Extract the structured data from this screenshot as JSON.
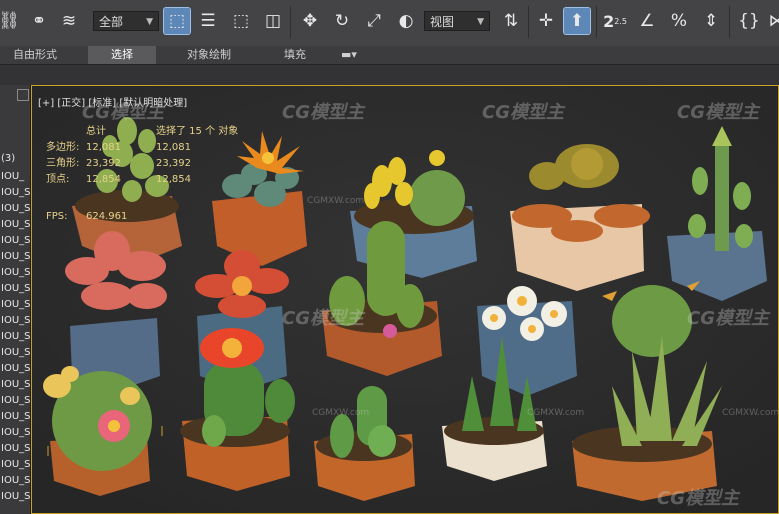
{
  "toolbar": {
    "filter_select": "全部",
    "ref_coord_select": "视图",
    "icons": [
      "link-icon",
      "unlink-icon",
      "bind-spacewarp-icon",
      "select-object-icon",
      "select-by-name-icon",
      "rect-region-icon",
      "window-crossing-icon",
      "move-icon",
      "rotate-icon",
      "scale-icon",
      "selection-lock-icon",
      "mirror-icon",
      "snap-toggle-icon",
      "pivot-icon",
      "angle-snap-icon",
      "percent-snap-icon",
      "spinner-snap-icon",
      "curly-braces-icon"
    ],
    "snap_label": "2.5"
  },
  "ribbon": {
    "tabs": [
      "自由形式",
      "选择",
      "对象绘制",
      "填充"
    ],
    "active_tab": "选择"
  },
  "left_panel": {
    "header": "(3)",
    "rows": [
      "IOU_",
      "IOU_S",
      "IOU_S",
      "IOU_S",
      "IOU_S",
      "IOU_S",
      "IOU_S",
      "IOU_S",
      "IOU_S",
      "IOU_S",
      "IOU_S",
      "IOU_S",
      "IOU_S",
      "IOU_S",
      "IOU_S",
      "IOU_S",
      "IOU_S",
      "IOU_S",
      "IOU_S",
      "IOU_S",
      "IOU_S"
    ]
  },
  "viewport": {
    "label": "[+] [正交] [标准] [默认明暗处理]",
    "stats": {
      "total_label": "总计",
      "selected_label": "选择了 15 个 对象",
      "rows": [
        {
          "label": "多边形:",
          "total": "12,081",
          "selected": "12,081"
        },
        {
          "label": "三角形:",
          "total": "23,392",
          "selected": "23,392"
        },
        {
          "label": "顶点:",
          "total": "12,854",
          "selected": "12,854"
        }
      ],
      "fps_label": "FPS:",
      "fps_value": "624.961"
    },
    "watermark": "CG模型主",
    "watermark_url": "CGMXW.com",
    "border_color": "#c9a227"
  }
}
